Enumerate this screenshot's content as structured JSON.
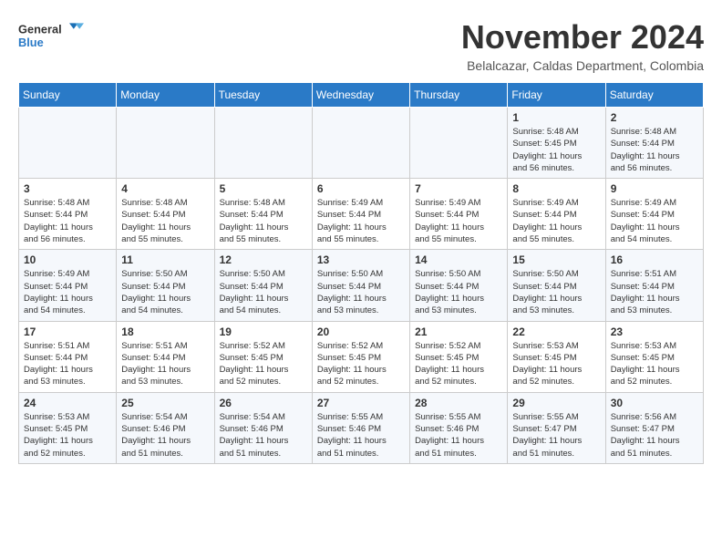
{
  "header": {
    "logo_general": "General",
    "logo_blue": "Blue",
    "month": "November 2024",
    "location": "Belalcazar, Caldas Department, Colombia"
  },
  "weekdays": [
    "Sunday",
    "Monday",
    "Tuesday",
    "Wednesday",
    "Thursday",
    "Friday",
    "Saturday"
  ],
  "weeks": [
    [
      {
        "day": "",
        "info": ""
      },
      {
        "day": "",
        "info": ""
      },
      {
        "day": "",
        "info": ""
      },
      {
        "day": "",
        "info": ""
      },
      {
        "day": "",
        "info": ""
      },
      {
        "day": "1",
        "info": "Sunrise: 5:48 AM\nSunset: 5:45 PM\nDaylight: 11 hours\nand 56 minutes."
      },
      {
        "day": "2",
        "info": "Sunrise: 5:48 AM\nSunset: 5:44 PM\nDaylight: 11 hours\nand 56 minutes."
      }
    ],
    [
      {
        "day": "3",
        "info": "Sunrise: 5:48 AM\nSunset: 5:44 PM\nDaylight: 11 hours\nand 56 minutes."
      },
      {
        "day": "4",
        "info": "Sunrise: 5:48 AM\nSunset: 5:44 PM\nDaylight: 11 hours\nand 55 minutes."
      },
      {
        "day": "5",
        "info": "Sunrise: 5:48 AM\nSunset: 5:44 PM\nDaylight: 11 hours\nand 55 minutes."
      },
      {
        "day": "6",
        "info": "Sunrise: 5:49 AM\nSunset: 5:44 PM\nDaylight: 11 hours\nand 55 minutes."
      },
      {
        "day": "7",
        "info": "Sunrise: 5:49 AM\nSunset: 5:44 PM\nDaylight: 11 hours\nand 55 minutes."
      },
      {
        "day": "8",
        "info": "Sunrise: 5:49 AM\nSunset: 5:44 PM\nDaylight: 11 hours\nand 55 minutes."
      },
      {
        "day": "9",
        "info": "Sunrise: 5:49 AM\nSunset: 5:44 PM\nDaylight: 11 hours\nand 54 minutes."
      }
    ],
    [
      {
        "day": "10",
        "info": "Sunrise: 5:49 AM\nSunset: 5:44 PM\nDaylight: 11 hours\nand 54 minutes."
      },
      {
        "day": "11",
        "info": "Sunrise: 5:50 AM\nSunset: 5:44 PM\nDaylight: 11 hours\nand 54 minutes."
      },
      {
        "day": "12",
        "info": "Sunrise: 5:50 AM\nSunset: 5:44 PM\nDaylight: 11 hours\nand 54 minutes."
      },
      {
        "day": "13",
        "info": "Sunrise: 5:50 AM\nSunset: 5:44 PM\nDaylight: 11 hours\nand 53 minutes."
      },
      {
        "day": "14",
        "info": "Sunrise: 5:50 AM\nSunset: 5:44 PM\nDaylight: 11 hours\nand 53 minutes."
      },
      {
        "day": "15",
        "info": "Sunrise: 5:50 AM\nSunset: 5:44 PM\nDaylight: 11 hours\nand 53 minutes."
      },
      {
        "day": "16",
        "info": "Sunrise: 5:51 AM\nSunset: 5:44 PM\nDaylight: 11 hours\nand 53 minutes."
      }
    ],
    [
      {
        "day": "17",
        "info": "Sunrise: 5:51 AM\nSunset: 5:44 PM\nDaylight: 11 hours\nand 53 minutes."
      },
      {
        "day": "18",
        "info": "Sunrise: 5:51 AM\nSunset: 5:44 PM\nDaylight: 11 hours\nand 53 minutes."
      },
      {
        "day": "19",
        "info": "Sunrise: 5:52 AM\nSunset: 5:45 PM\nDaylight: 11 hours\nand 52 minutes."
      },
      {
        "day": "20",
        "info": "Sunrise: 5:52 AM\nSunset: 5:45 PM\nDaylight: 11 hours\nand 52 minutes."
      },
      {
        "day": "21",
        "info": "Sunrise: 5:52 AM\nSunset: 5:45 PM\nDaylight: 11 hours\nand 52 minutes."
      },
      {
        "day": "22",
        "info": "Sunrise: 5:53 AM\nSunset: 5:45 PM\nDaylight: 11 hours\nand 52 minutes."
      },
      {
        "day": "23",
        "info": "Sunrise: 5:53 AM\nSunset: 5:45 PM\nDaylight: 11 hours\nand 52 minutes."
      }
    ],
    [
      {
        "day": "24",
        "info": "Sunrise: 5:53 AM\nSunset: 5:45 PM\nDaylight: 11 hours\nand 52 minutes."
      },
      {
        "day": "25",
        "info": "Sunrise: 5:54 AM\nSunset: 5:46 PM\nDaylight: 11 hours\nand 51 minutes."
      },
      {
        "day": "26",
        "info": "Sunrise: 5:54 AM\nSunset: 5:46 PM\nDaylight: 11 hours\nand 51 minutes."
      },
      {
        "day": "27",
        "info": "Sunrise: 5:55 AM\nSunset: 5:46 PM\nDaylight: 11 hours\nand 51 minutes."
      },
      {
        "day": "28",
        "info": "Sunrise: 5:55 AM\nSunset: 5:46 PM\nDaylight: 11 hours\nand 51 minutes."
      },
      {
        "day": "29",
        "info": "Sunrise: 5:55 AM\nSunset: 5:47 PM\nDaylight: 11 hours\nand 51 minutes."
      },
      {
        "day": "30",
        "info": "Sunrise: 5:56 AM\nSunset: 5:47 PM\nDaylight: 11 hours\nand 51 minutes."
      }
    ]
  ]
}
